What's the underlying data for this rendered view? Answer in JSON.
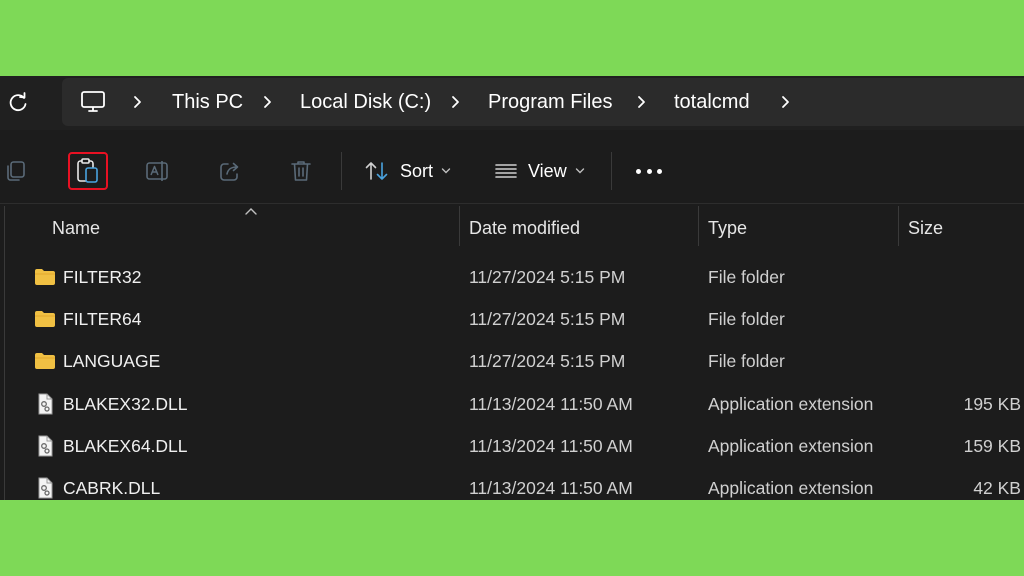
{
  "breadcrumb": {
    "items": [
      {
        "label": "This PC"
      },
      {
        "label": "Local Disk (C:)"
      },
      {
        "label": "Program Files"
      },
      {
        "label": "totalcmd"
      }
    ]
  },
  "toolbar": {
    "sort_label": "Sort",
    "view_label": "View",
    "highlighted_button": "paste-button"
  },
  "columns": [
    "Name",
    "Date modified",
    "Type",
    "Size"
  ],
  "files": [
    {
      "name": "FILTER32",
      "date": "11/27/2024 5:15 PM",
      "type": "File folder",
      "size": "",
      "icon": "folder-icon"
    },
    {
      "name": "FILTER64",
      "date": "11/27/2024 5:15 PM",
      "type": "File folder",
      "size": "",
      "icon": "folder-icon"
    },
    {
      "name": "LANGUAGE",
      "date": "11/27/2024 5:15 PM",
      "type": "File folder",
      "size": "",
      "icon": "folder-icon"
    },
    {
      "name": "BLAKEX32.DLL",
      "date": "11/13/2024 11:50 AM",
      "type": "Application extension",
      "size": "195 KB",
      "icon": "dll-file-icon"
    },
    {
      "name": "BLAKEX64.DLL",
      "date": "11/13/2024 11:50 AM",
      "type": "Application extension",
      "size": "159 KB",
      "icon": "dll-file-icon"
    },
    {
      "name": "CABRK.DLL",
      "date": "11/13/2024 11:50 AM",
      "type": "Application extension",
      "size": "42 KB",
      "icon": "dll-file-icon"
    }
  ],
  "colors": {
    "background": "#7ed957",
    "window": "#1c1c1c",
    "folder": "#f0c043",
    "highlight": "#e81123"
  }
}
